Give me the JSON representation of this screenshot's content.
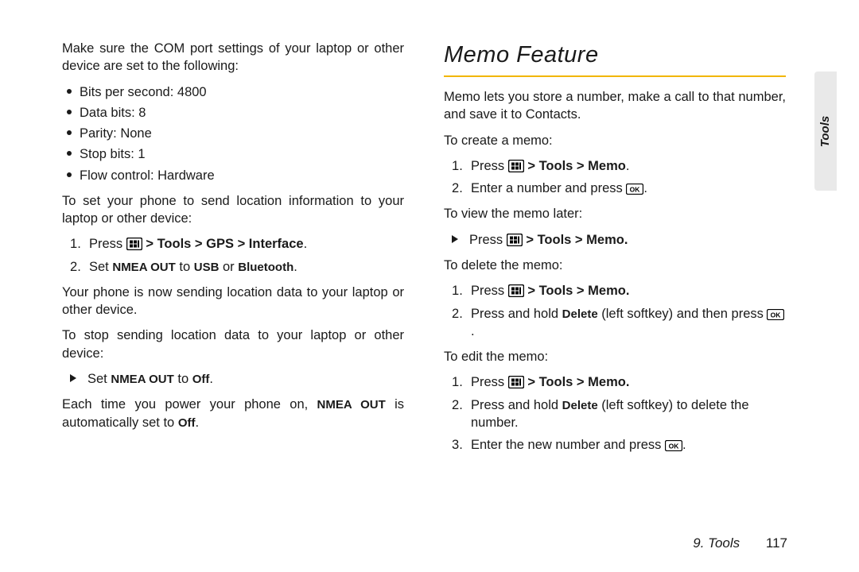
{
  "left": {
    "intro": "Make sure the COM port settings of your laptop or other device are set to the following:",
    "settings": [
      "Bits per second: 4800",
      "Data bits: 8",
      "Parity: None",
      "Stop bits: 1",
      "Flow control: Hardware"
    ],
    "sect1": "To set your phone to send location information to your laptop or other device:",
    "step1_a": "Press ",
    "step1_b": " > Tools > GPS > Interface",
    "step1_c": ".",
    "step2_a": "Set ",
    "step2_b": "NMEA OUT",
    "step2_c": " to ",
    "step2_d": "USB",
    "step2_e": " or ",
    "step2_f": "Bluetooth",
    "step2_g": ".",
    "after": "Your phone is now sending location data to your laptop or other device.",
    "sect2": "To stop sending location data to your laptop or other device:",
    "tri_a": "Set ",
    "tri_b": "NMEA OUT",
    "tri_c": " to ",
    "tri_d": "Off",
    "tri_e": ".",
    "last_a": "Each time you power your phone on, ",
    "last_b": "NMEA OUT",
    "last_c": " is automatically set to ",
    "last_d": "Off",
    "last_e": "."
  },
  "right": {
    "heading": "Memo Feature",
    "intro": "Memo lets you store a number, make a call to that number, and save it to Contacts.",
    "create_h": "To create a memo:",
    "create_1a": "Press ",
    "create_1b": " > Tools > Memo",
    "create_1c": ".",
    "create_2a": "Enter a number and press ",
    "create_2b": ".",
    "view_h": "To view the memo later:",
    "view_a": "Press ",
    "view_b": " > Tools > Memo.",
    "delete_h": "To delete the memo:",
    "del_1a": "Press ",
    "del_1b": " > Tools > Memo.",
    "del_2a": "Press and hold ",
    "del_2b": "Delete",
    "del_2c": " (left softkey) and then press ",
    "del_2d": ".",
    "edit_h": "To edit the memo:",
    "ed_1a": "Press ",
    "ed_1b": " > Tools > Memo.",
    "ed_2a": "Press and hold ",
    "ed_2b": "Delete",
    "ed_2c": " (left softkey) to delete the number.",
    "ed_3a": "Enter the new number and press ",
    "ed_3b": "."
  },
  "tab_label": "Tools",
  "footer_section": "9. Tools",
  "footer_page": "117"
}
